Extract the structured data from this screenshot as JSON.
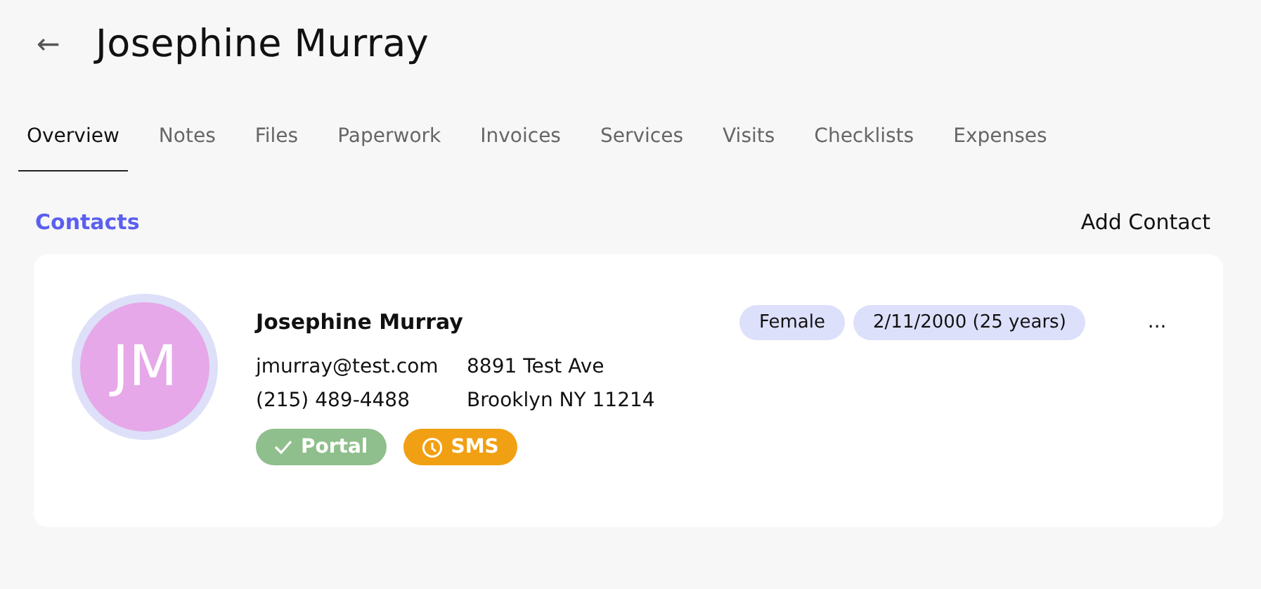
{
  "header": {
    "back": "←",
    "title": "Josephine Murray"
  },
  "tabs": [
    {
      "label": "Overview",
      "selected": true
    },
    {
      "label": "Notes",
      "selected": false
    },
    {
      "label": "Files",
      "selected": false
    },
    {
      "label": "Paperwork",
      "selected": false
    },
    {
      "label": "Invoices",
      "selected": false
    },
    {
      "label": "Services",
      "selected": false
    },
    {
      "label": "Visits",
      "selected": false
    },
    {
      "label": "Checklists",
      "selected": false
    },
    {
      "label": "Expenses",
      "selected": false
    }
  ],
  "contacts": {
    "heading": "Contacts",
    "add_button": "Add Contact",
    "items": [
      {
        "initials": "JM",
        "name": "Josephine Murray",
        "email": "jmurray@test.com",
        "address_line_1": "8891 Test Ave",
        "phone": "(215) 489-4488",
        "address_line_2": "Brooklyn NY 11214",
        "tags": [
          "Female",
          "2/11/2000 (25 years)"
        ],
        "more": "...",
        "badges": [
          {
            "label": "Portal",
            "kind": "check",
            "color": "#8fbf8c"
          },
          {
            "label": "SMS",
            "kind": "clock",
            "color": "#f0a012"
          }
        ]
      }
    ]
  }
}
